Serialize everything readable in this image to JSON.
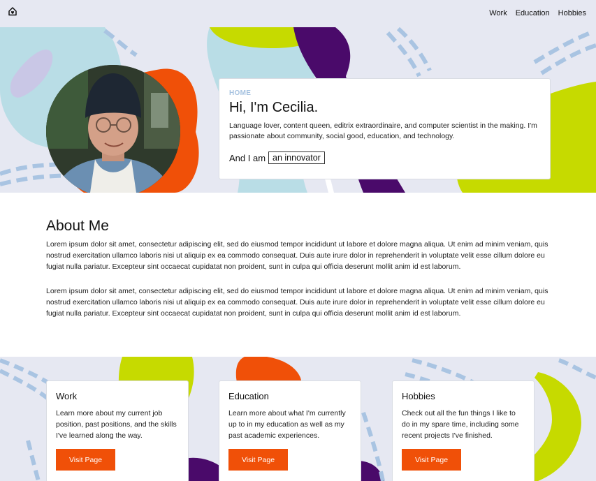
{
  "nav": {
    "logo_icon": "home-heart-icon",
    "links": [
      "Work",
      "Education",
      "Hobbies"
    ]
  },
  "hero": {
    "kicker": "HOME",
    "title": "Hi, I'm Cecilia.",
    "description": "Language lover, content queen, editrix extraordinaire, and computer scientist in the making. I'm passionate about community, social good, education, and technology.",
    "iam_prefix": "And I am",
    "iam_role": "an innovator"
  },
  "about": {
    "heading": "About Me",
    "paragraphs": [
      "Lorem ipsum dolor sit amet, consectetur adipiscing elit, sed do eiusmod tempor incididunt ut labore et dolore magna aliqua. Ut enim ad minim veniam, quis nostrud exercitation ullamco laboris nisi ut aliquip ex ea commodo consequat. Duis aute irure dolor in reprehenderit in voluptate velit esse cillum dolore eu fugiat nulla pariatur. Excepteur sint occaecat cupidatat non proident, sunt in culpa qui officia deserunt mollit anim id est laborum.",
      "Lorem ipsum dolor sit amet, consectetur adipiscing elit, sed do eiusmod tempor incididunt ut labore et dolore magna aliqua. Ut enim ad minim veniam, quis nostrud exercitation ullamco laboris nisi ut aliquip ex ea commodo consequat. Duis aute irure dolor in reprehenderit in voluptate velit esse cillum dolore eu fugiat nulla pariatur. Excepteur sint occaecat cupidatat non proident, sunt in culpa qui officia deserunt mollit anim id est laborum."
    ]
  },
  "cards": [
    {
      "title": "Work",
      "text": "Learn more about my current job position, past positions, and the skills I've learned along the way.",
      "button": "Visit Page"
    },
    {
      "title": "Education",
      "text": "Learn more about what I'm currently up to in my education as well as my past academic experiences.",
      "button": "Visit Page"
    },
    {
      "title": "Hobbies",
      "text": "Check out all the fun things I like to do in my spare time, including some recent projects I've finished.",
      "button": "Visit Page"
    }
  ],
  "colors": {
    "background": "#e6e8f2",
    "orange": "#f05008",
    "lime": "#c6da00",
    "purple": "#4a0a6a",
    "light_blue": "#b9dde6",
    "dash_blue": "#a9c4e2",
    "kicker": "#a6c2e0"
  }
}
